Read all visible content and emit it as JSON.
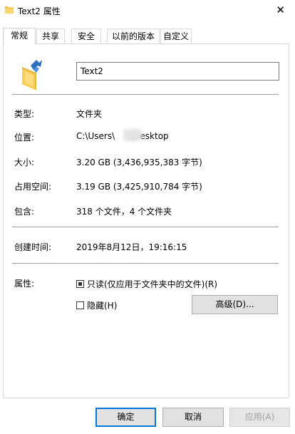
{
  "window": {
    "title": "Text2 属性",
    "close_glyph": "✕"
  },
  "tabs": [
    {
      "label": "常规",
      "active": true
    },
    {
      "label": "共享",
      "active": false
    },
    {
      "label": "安全",
      "active": false
    },
    {
      "label": "以前的版本",
      "active": false
    },
    {
      "label": "自定义",
      "active": false
    }
  ],
  "general": {
    "name": "Text2",
    "type_label": "类型:",
    "type_value": "文件夹",
    "location_label": "位置:",
    "location_value_prefix": "C:\\Users\\",
    "location_value_suffix": "\\Desktop",
    "size_label": "大小:",
    "size_value": "3.20 GB (3,436,935,383 字节)",
    "size_on_disk_label": "占用空间:",
    "size_on_disk_value": "3.19 GB (3,425,910,784 字节)",
    "contains_label": "包含:",
    "contains_value": "318 个文件，4 个文件夹",
    "created_label": "创建时间:",
    "created_value": "2019年8月12日，19:16:15",
    "attributes_label": "属性:",
    "readonly_label": "只读(仅应用于文件夹中的文件)(R)",
    "readonly_checked": true,
    "hidden_label": "隐藏(H)",
    "hidden_checked": false,
    "advanced_button": "高级(D)..."
  },
  "footer": {
    "ok": "确定",
    "cancel": "取消",
    "apply": "应用(A)"
  },
  "colors": {
    "folder": "#f4c542",
    "accent": "#0078d7",
    "button_bg": "#e1e1e1"
  }
}
